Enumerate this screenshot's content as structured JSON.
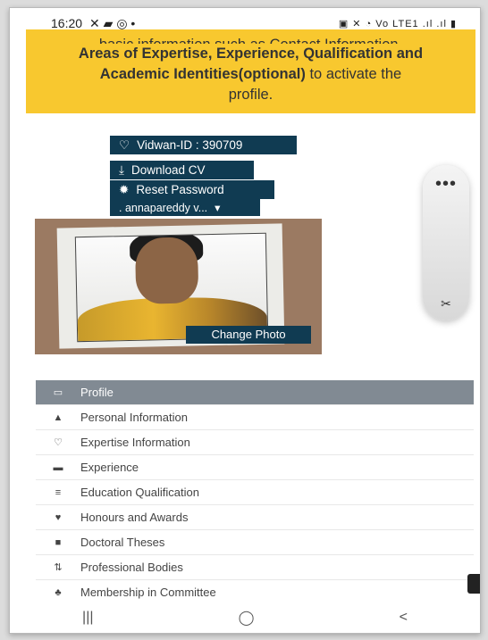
{
  "status_bar": {
    "time": "16:20",
    "left_icons": "✕ ▰ ◎ •",
    "right_icons": "▣ ✕ ◔ Vo LTE1 .ıl .ıl ▮"
  },
  "banner": {
    "cut_line": "basic information such as Contact Information,",
    "line2": "Areas of Expertise, Experience, Qualification and",
    "line3_bold": "Academic Identities(optional)",
    "line3_rest": " to activate the",
    "line4": "profile."
  },
  "vidwan_id": "Vidwan-ID : 390709",
  "download_cv": "Download CV",
  "reset_password": "Reset Password",
  "username": ". annapareddy v...",
  "change_photo": "Change Photo",
  "floating_tool": {
    "dots": "•••",
    "icon": "✂"
  },
  "menu": {
    "items": [
      {
        "label": "Profile",
        "icon": "monitor-icon",
        "glyph": "▭"
      },
      {
        "label": "Personal Information",
        "icon": "user-icon",
        "glyph": "▲"
      },
      {
        "label": "Expertise Information",
        "icon": "lightbulb-icon",
        "glyph": "♡"
      },
      {
        "label": "Experience",
        "icon": "briefcase-icon",
        "glyph": "▬"
      },
      {
        "label": "Education Qualification",
        "icon": "graduation-cap-icon",
        "glyph": "≡"
      },
      {
        "label": "Honours and Awards",
        "icon": "trophy-icon",
        "glyph": "♥"
      },
      {
        "label": "Doctoral Theses",
        "icon": "book-icon",
        "glyph": "■"
      },
      {
        "label": "Professional Bodies",
        "icon": "sort-icon",
        "glyph": "⇅"
      },
      {
        "label": "Membership in Committee",
        "icon": "users-icon",
        "glyph": "♣"
      }
    ]
  },
  "navbar": {
    "recents": "|||",
    "home": "◯",
    "back": "<"
  },
  "colors": {
    "banner": "#f8c82f",
    "button": "#103b52",
    "menu_active": "#818a93"
  }
}
